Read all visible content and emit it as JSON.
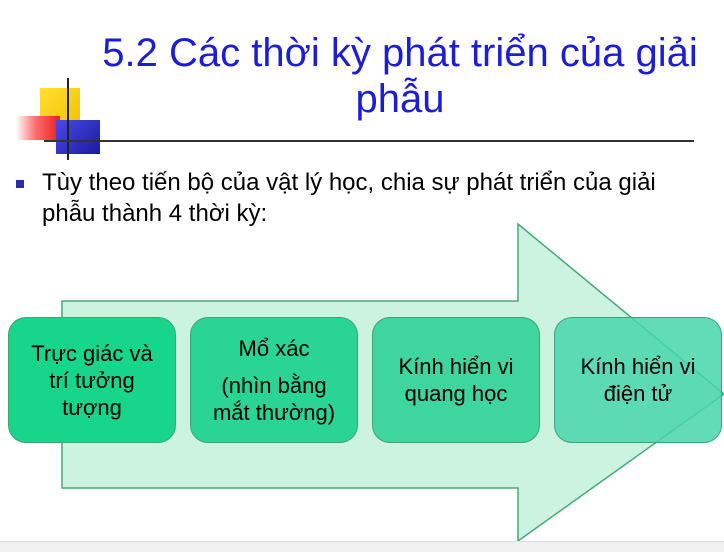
{
  "slide": {
    "title": "5.2 Các thời kỳ phát triển của giải phẫu",
    "bullet_text": "Tùy theo tiến bộ của vật lý học, chia sự phát triển của giải phẫu thành 4 thời kỳ:",
    "stages": [
      {
        "line1": "Trực giác và",
        "line2": "trí tưởng",
        "line3": "tượng"
      },
      {
        "line1": "Mổ xác",
        "line2": "(nhìn bằng",
        "line3": "mắt thường)"
      },
      {
        "line1": "Kính hiển vi",
        "line2": "quang học"
      },
      {
        "line1": "Kính hiển vi",
        "line2": "điện tử"
      }
    ]
  },
  "colors": {
    "title": "#1d1dd6",
    "arrow_fill": "#ccf2e0",
    "arrow_stroke": "#4aa77a",
    "stage_border": "#39a57a"
  }
}
